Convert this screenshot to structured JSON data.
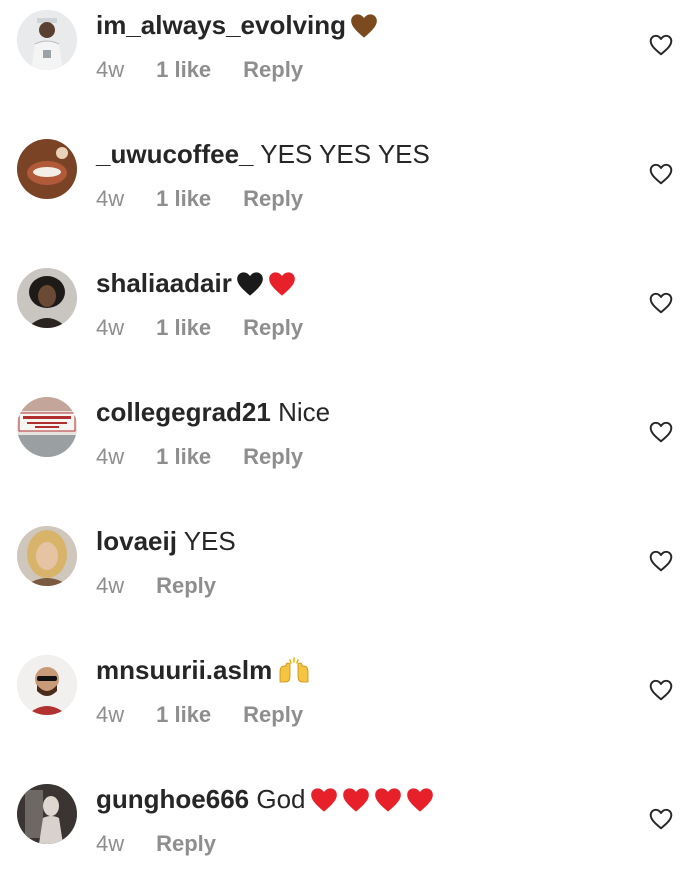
{
  "colors": {
    "text": "#262626",
    "meta": "#8e8e8e",
    "red_heart": "#e8202a",
    "black_heart": "#1a1a1a",
    "brown_heart": "#7b4a1e"
  },
  "comments": [
    {
      "username": "im_always_evolving",
      "text": "",
      "emojis": [
        "brown-heart"
      ],
      "time": "4w",
      "likes": "1 like",
      "reply": "Reply"
    },
    {
      "username": "_uwucoffee_",
      "text": "YES YES YES",
      "emojis": [],
      "time": "4w",
      "likes": "1 like",
      "reply": "Reply"
    },
    {
      "username": "shaliaadair",
      "text": "",
      "emojis": [
        "black-heart",
        "red-heart"
      ],
      "time": "4w",
      "likes": "1 like",
      "reply": "Reply"
    },
    {
      "username": "collegegrad21",
      "text": "Nice",
      "emojis": [],
      "time": "4w",
      "likes": "1 like",
      "reply": "Reply"
    },
    {
      "username": "lovaeij",
      "text": "YES",
      "emojis": [],
      "time": "4w",
      "likes": "",
      "reply": "Reply"
    },
    {
      "username": "mnsuurii.aslm",
      "text": "",
      "emojis": [
        "raising-hands"
      ],
      "time": "4w",
      "likes": "1 like",
      "reply": "Reply"
    },
    {
      "username": "gunghoe666",
      "text": "God",
      "emojis": [
        "red-heart",
        "red-heart",
        "red-heart",
        "red-heart"
      ],
      "time": "4w",
      "likes": "",
      "reply": "Reply"
    }
  ]
}
